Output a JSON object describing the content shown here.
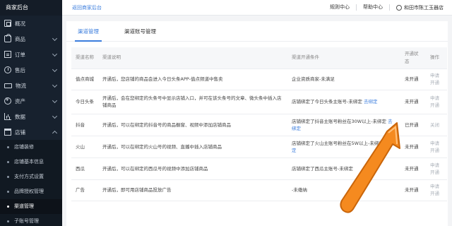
{
  "sidebar": {
    "brand": "商家后台",
    "items": [
      {
        "label": "概况",
        "icon": "overview-icon"
      },
      {
        "label": "商品",
        "icon": "goods-icon"
      },
      {
        "label": "订单",
        "icon": "order-icon"
      },
      {
        "label": "售后",
        "icon": "after-sale-icon"
      },
      {
        "label": "物流",
        "icon": "logistics-icon"
      },
      {
        "label": "资产",
        "icon": "assets-icon"
      },
      {
        "label": "数据",
        "icon": "data-icon"
      },
      {
        "label": "店铺",
        "icon": "shop-icon"
      }
    ],
    "submenu": [
      "店铺装修",
      "店铺基本信息",
      "支付方式设置",
      "品牌授权管理",
      "渠道管理",
      "子账号管理"
    ],
    "active_sub": "渠道管理"
  },
  "header": {
    "back_link": "返回商家后台",
    "rules": "规则中心",
    "help": "帮助中心",
    "shop_name": "和田市陈工玉器店"
  },
  "tabs": [
    "渠道管理",
    "渠道账号管理"
  ],
  "table": {
    "headers": [
      "渠道名称",
      "渠道说明",
      "渠道开通条件",
      "开通状态",
      "操作"
    ],
    "rows": [
      {
        "name": "值点商城",
        "desc": "开通后，您店铺的商品会进入今日头条APP-值点频道中售卖",
        "cond": "企业资质商家-未满足",
        "cond_link": "",
        "status": "未开通",
        "op": "申请开通"
      },
      {
        "name": "今日头条",
        "desc": "开通后，会在您绑定的头条号中显示店铺入口，并可在该头条号的文章、微头条中插入店铺商品",
        "cond": "店铺绑定了今日头条主账号-未绑定",
        "cond_link": "去绑定",
        "status": "未开通",
        "op": "申请开通"
      },
      {
        "name": "抖音",
        "desc": "开通后，可以在绑定的抖音号的商品橱窗、视频中添加店铺商品",
        "cond": "店铺绑定了抖音主账号粉丝在30W以上-未绑定",
        "cond_link": "去绑定",
        "status": "已开通",
        "op": "关闭"
      },
      {
        "name": "火山",
        "desc": "开通后，可以在绑定的火山号的视频、直播中插入店铺商品",
        "cond": "店铺绑定了火山主账号粉丝在5W以上-未绑定",
        "cond_link": "去绑定",
        "status": "未开通",
        "op": "申请开通"
      },
      {
        "name": "西瓜",
        "desc": "开通后，可以在绑定的西瓜号的视频中添加店铺商品",
        "cond": "店铺绑定了西瓜主账号-未绑定",
        "cond_link": "",
        "status": "未开通",
        "op": "申请开通"
      },
      {
        "name": "广告",
        "desc": "开通后，即可用店铺商品投放广告",
        "cond": "-未缴纳",
        "cond_link": "",
        "status": "未开通",
        "op": "申请开通"
      }
    ]
  },
  "colors": {
    "accent": "#3b7ddd",
    "sidebar_bg": "#17212e",
    "arrow": "#f58a1f"
  }
}
